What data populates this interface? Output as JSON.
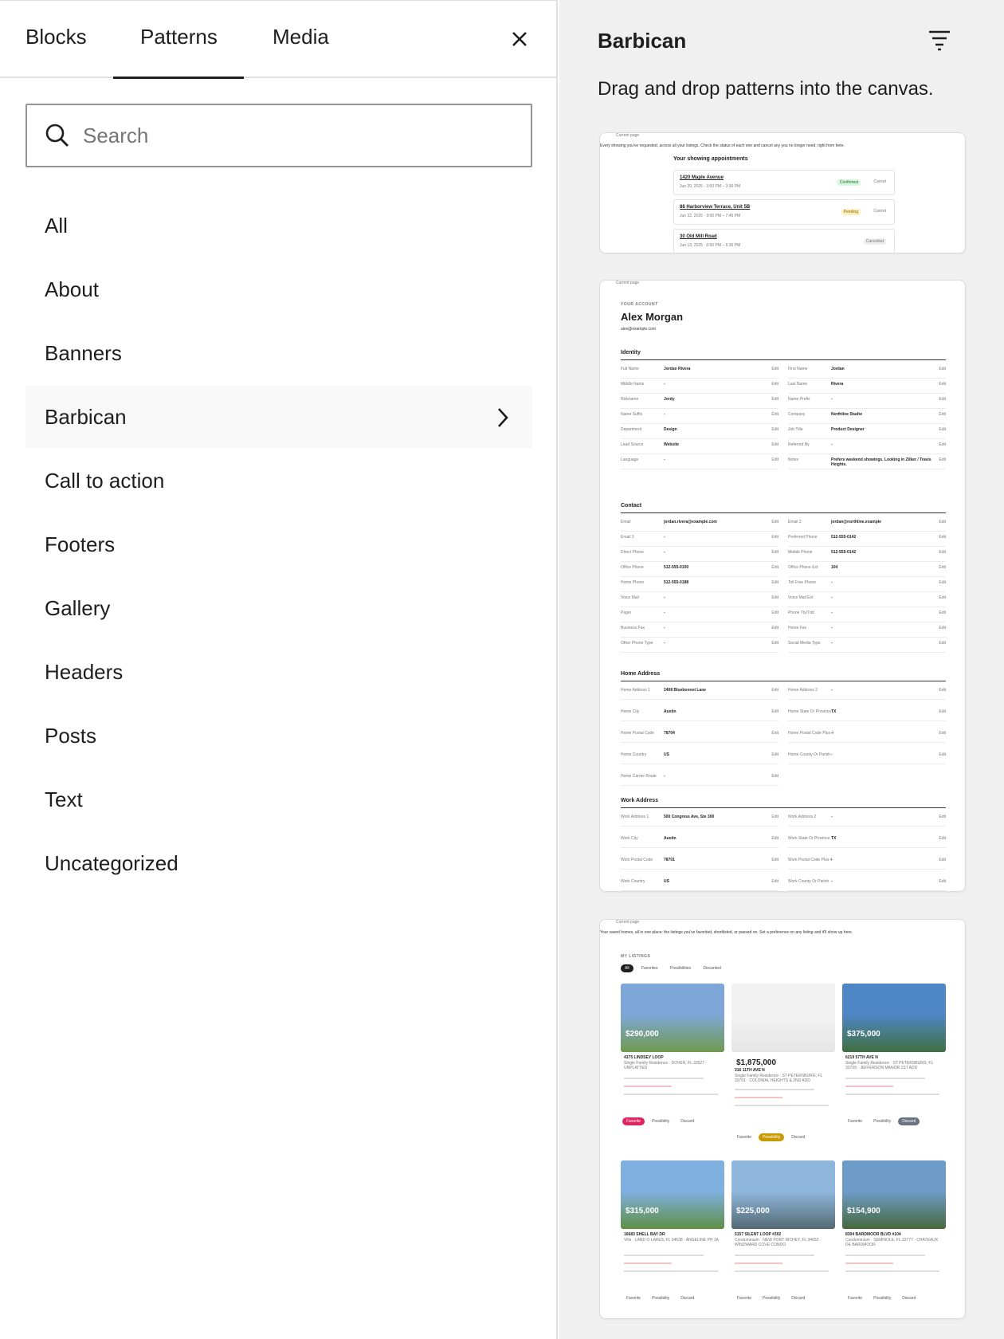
{
  "tabs": {
    "blocks": "Blocks",
    "patterns": "Patterns",
    "media": "Media"
  },
  "search": {
    "placeholder": "Search"
  },
  "categories": [
    "All",
    "About",
    "Banners",
    "Barbican",
    "Call to action",
    "Footers",
    "Gallery",
    "Headers",
    "Posts",
    "Text",
    "Uncategorized"
  ],
  "panel": {
    "title": "Barbican",
    "description": "Drag and drop patterns into the canvas."
  },
  "card1": {
    "breadcrumb": "Current page",
    "intro": "Every showing you've requested, across all your listings. Check the status of each one and cancel any you no longer need, right from here.",
    "heading": "Your showing appointments",
    "appointments": [
      {
        "address": "1420 Maple Avenue",
        "date": "Jun 20, 2025 · 3:00 PM – 3:30 PM",
        "status": "Confirmed",
        "action": "Cancel"
      },
      {
        "address": "88 Harborview Terrace, Unit 5B",
        "date": "Jun 22, 2025 · 9:00 PM – 7:45 PM",
        "status": "Pending",
        "action": "Cancel"
      },
      {
        "address": "30 Old Mill Road",
        "date": "Jun 13, 2025 · 6:00 PM – 6:30 PM",
        "status": "Cancelled",
        "action": ""
      }
    ]
  },
  "card2": {
    "breadcrumb": "Current page",
    "eyebrow": "YOUR ACCOUNT",
    "name": "Alex Morgan",
    "email": "alex@example.com",
    "sections": [
      "Identity",
      "Contact",
      "Home Address",
      "Work Address"
    ],
    "identity": [
      [
        "Full Name",
        "Jordan Rivera",
        "First Name",
        "Jordan"
      ],
      [
        "Middle Name",
        "-",
        "Last Name",
        "Rivera"
      ],
      [
        "Nickname",
        "Jordy",
        "Name Prefix",
        "-"
      ],
      [
        "Name Suffix",
        "-",
        "Company",
        "Northline Studio"
      ],
      [
        "Department",
        "Design",
        "Job Title",
        "Product Designer"
      ],
      [
        "Lead Source",
        "Website",
        "Referred By",
        "-"
      ],
      [
        "Language",
        "-",
        "Notes",
        "Prefers weekend showings. Looking in Zilker / Travis Heights."
      ]
    ],
    "contact": [
      [
        "Email",
        "jordan.rivera@example.com",
        "Email 2",
        "jordan@northline.example"
      ],
      [
        "Email 3",
        "-",
        "Preferred Phone",
        "512-555-0142"
      ],
      [
        "Direct Phone",
        "-",
        "Mobile Phone",
        "512-555-0142"
      ],
      [
        "Office Phone",
        "512-555-0100",
        "Office Phone Ext",
        "104"
      ],
      [
        "Home Phone",
        "512-555-0188",
        "Toll Free Phone",
        "-"
      ],
      [
        "Voice Mail",
        "-",
        "Voice Mail Ext",
        "-"
      ],
      [
        "Pager",
        "-",
        "Phone Tty/Tdd",
        "-"
      ],
      [
        "Business Fax",
        "-",
        "Home Fax",
        "-"
      ],
      [
        "Other Phone Type",
        "-",
        "Social Media Type",
        "-"
      ]
    ],
    "home": [
      [
        "Home Address 1",
        "2408 Bluebonnet Lane",
        "Home Address 2",
        "-"
      ],
      [
        "Home City",
        "Austin",
        "Home State Or Province",
        "TX"
      ],
      [
        "Home Postal Code",
        "78704",
        "Home Postal Code Plus 4",
        "-"
      ],
      [
        "Home Country",
        "US",
        "Home County Or Parish",
        "-"
      ],
      [
        "Home Carrier Route",
        "-",
        "",
        ""
      ]
    ],
    "work": [
      [
        "Work Address 1",
        "500 Congress Ave, Ste 300",
        "Work Address 2",
        "-"
      ],
      [
        "Work City",
        "Austin",
        "Work State Or Province",
        "TX"
      ],
      [
        "Work Postal Code",
        "78701",
        "Work Postal Code Plus 4",
        "-"
      ],
      [
        "Work Country",
        "US",
        "Work County Or Parish",
        "-"
      ]
    ],
    "edit_label": "Edit"
  },
  "card3": {
    "breadcrumb": "Current page",
    "intro": "Your saved homes, all in one place: the listings you've favorited, shortlisted, or passed on. Set a preference on any listing and it'll show up here.",
    "eyebrow": "MY LISTINGS",
    "filters": [
      "All",
      "Favorites",
      "Possibilities",
      "Discarded"
    ],
    "listings": [
      {
        "price": "$290,000",
        "address": "4375 LINDSEY LOOP",
        "sub": "Single Family Residence · DOVER, FL 33527 · UNPLATTED"
      },
      {
        "price": "$1,875,000",
        "address": "316 11TH AVE N",
        "sub": "Single Family Residence · ST PETERSBURG, FL 33701 · COLONIAL HEIGHTS & 2ND ADD"
      },
      {
        "price": "$375,000",
        "address": "6219 57TH AVE N",
        "sub": "Single Family Residence · ST PETERSBURG, FL 33709 · JEFFERSON MANOR 1ST ADD"
      },
      {
        "price": "$315,000",
        "address": "16683 SHELL BAY DR",
        "sub": "Villa · LAND O LAKES, FL 34638 · ANGELINE PH 1A"
      },
      {
        "price": "$225,000",
        "address": "5157 SILENT LOOP #302",
        "sub": "Condominium · NEW PORT RICHEY, FL 34652 · WINDWARD COVE CONDO"
      },
      {
        "price": "$154,900",
        "address": "8304 BARDMOOR BLVD #104",
        "sub": "Condominium · SEMINOLE, FL 33777 · CHATEAUX DE BARDMOOR"
      }
    ],
    "actions": [
      "Favorite",
      "Possibility",
      "Discard"
    ]
  }
}
